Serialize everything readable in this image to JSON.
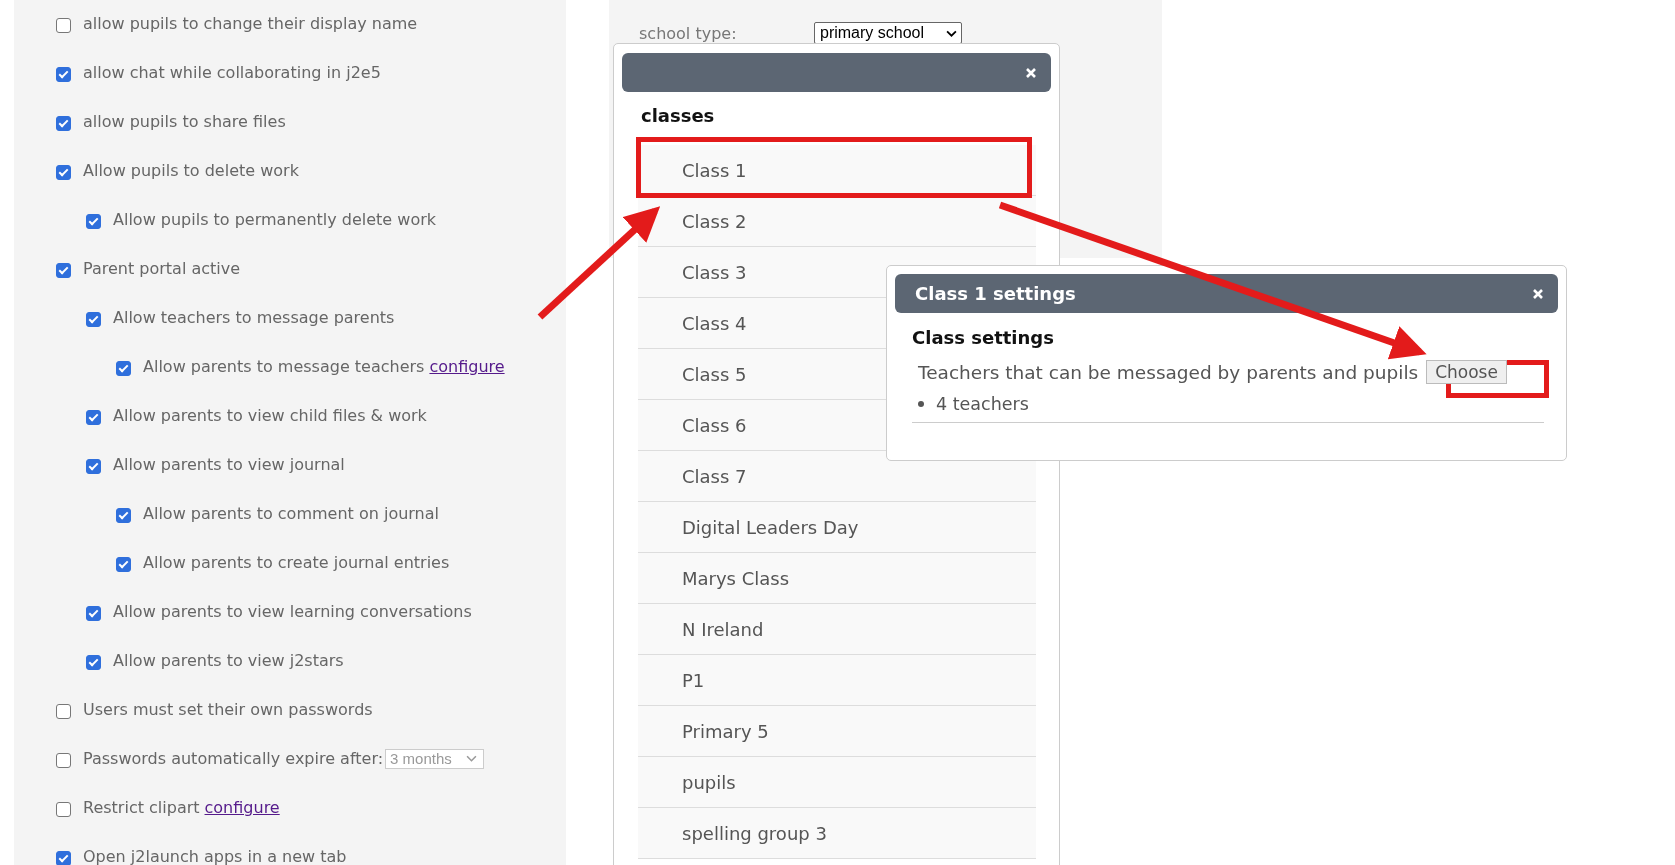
{
  "settings": [
    {
      "label": "allow pupils to change their display name",
      "checked": false
    },
    {
      "label": "allow chat while collaborating in j2e5",
      "checked": true
    },
    {
      "label": "allow pupils to share files",
      "checked": true
    },
    {
      "label": "Allow pupils to delete work",
      "checked": true,
      "children": [
        {
          "label": "Allow pupils to permanently delete work",
          "checked": true
        }
      ]
    },
    {
      "label": "Parent portal active",
      "checked": true,
      "children": [
        {
          "label": "Allow teachers to message parents",
          "checked": true,
          "children": [
            {
              "label": "Allow parents to message teachers",
              "checked": true,
              "link": "configure"
            }
          ]
        },
        {
          "label": "Allow parents to view child files & work",
          "checked": true
        },
        {
          "label": "Allow parents to view journal",
          "checked": true,
          "children": [
            {
              "label": "Allow parents to comment on journal",
              "checked": true
            },
            {
              "label": "Allow parents to create journal entries",
              "checked": true
            }
          ]
        },
        {
          "label": "Allow parents to view learning conversations",
          "checked": true
        },
        {
          "label": "Allow parents to view j2stars",
          "checked": true
        }
      ]
    },
    {
      "label": "Users must set their own passwords",
      "checked": false
    },
    {
      "label": "Passwords automatically expire after:",
      "checked": false,
      "select": {
        "value": "3 months",
        "disabled": true
      }
    },
    {
      "label": "Restrict clipart",
      "checked": false,
      "link": "configure"
    },
    {
      "label": "Open j2launch apps in a new tab",
      "checked": true
    }
  ],
  "school_type": {
    "label": "school type:",
    "value": "primary school"
  },
  "classes_dialog": {
    "heading": "classes",
    "items": [
      "Class 1",
      "Class 2",
      "Class 3",
      "Class 4",
      "Class 5",
      "Class 6",
      "Class 7",
      "Digital Leaders Day",
      "Marys Class",
      "N Ireland",
      "P1",
      "Primary 5",
      "pupils",
      "spelling group 3"
    ]
  },
  "class_settings_dialog": {
    "title": "Class 1 settings",
    "heading": "Class settings",
    "setting_label": "Teachers that can be messaged by parents and pupils",
    "button": "Choose",
    "items": [
      "4 teachers"
    ]
  }
}
